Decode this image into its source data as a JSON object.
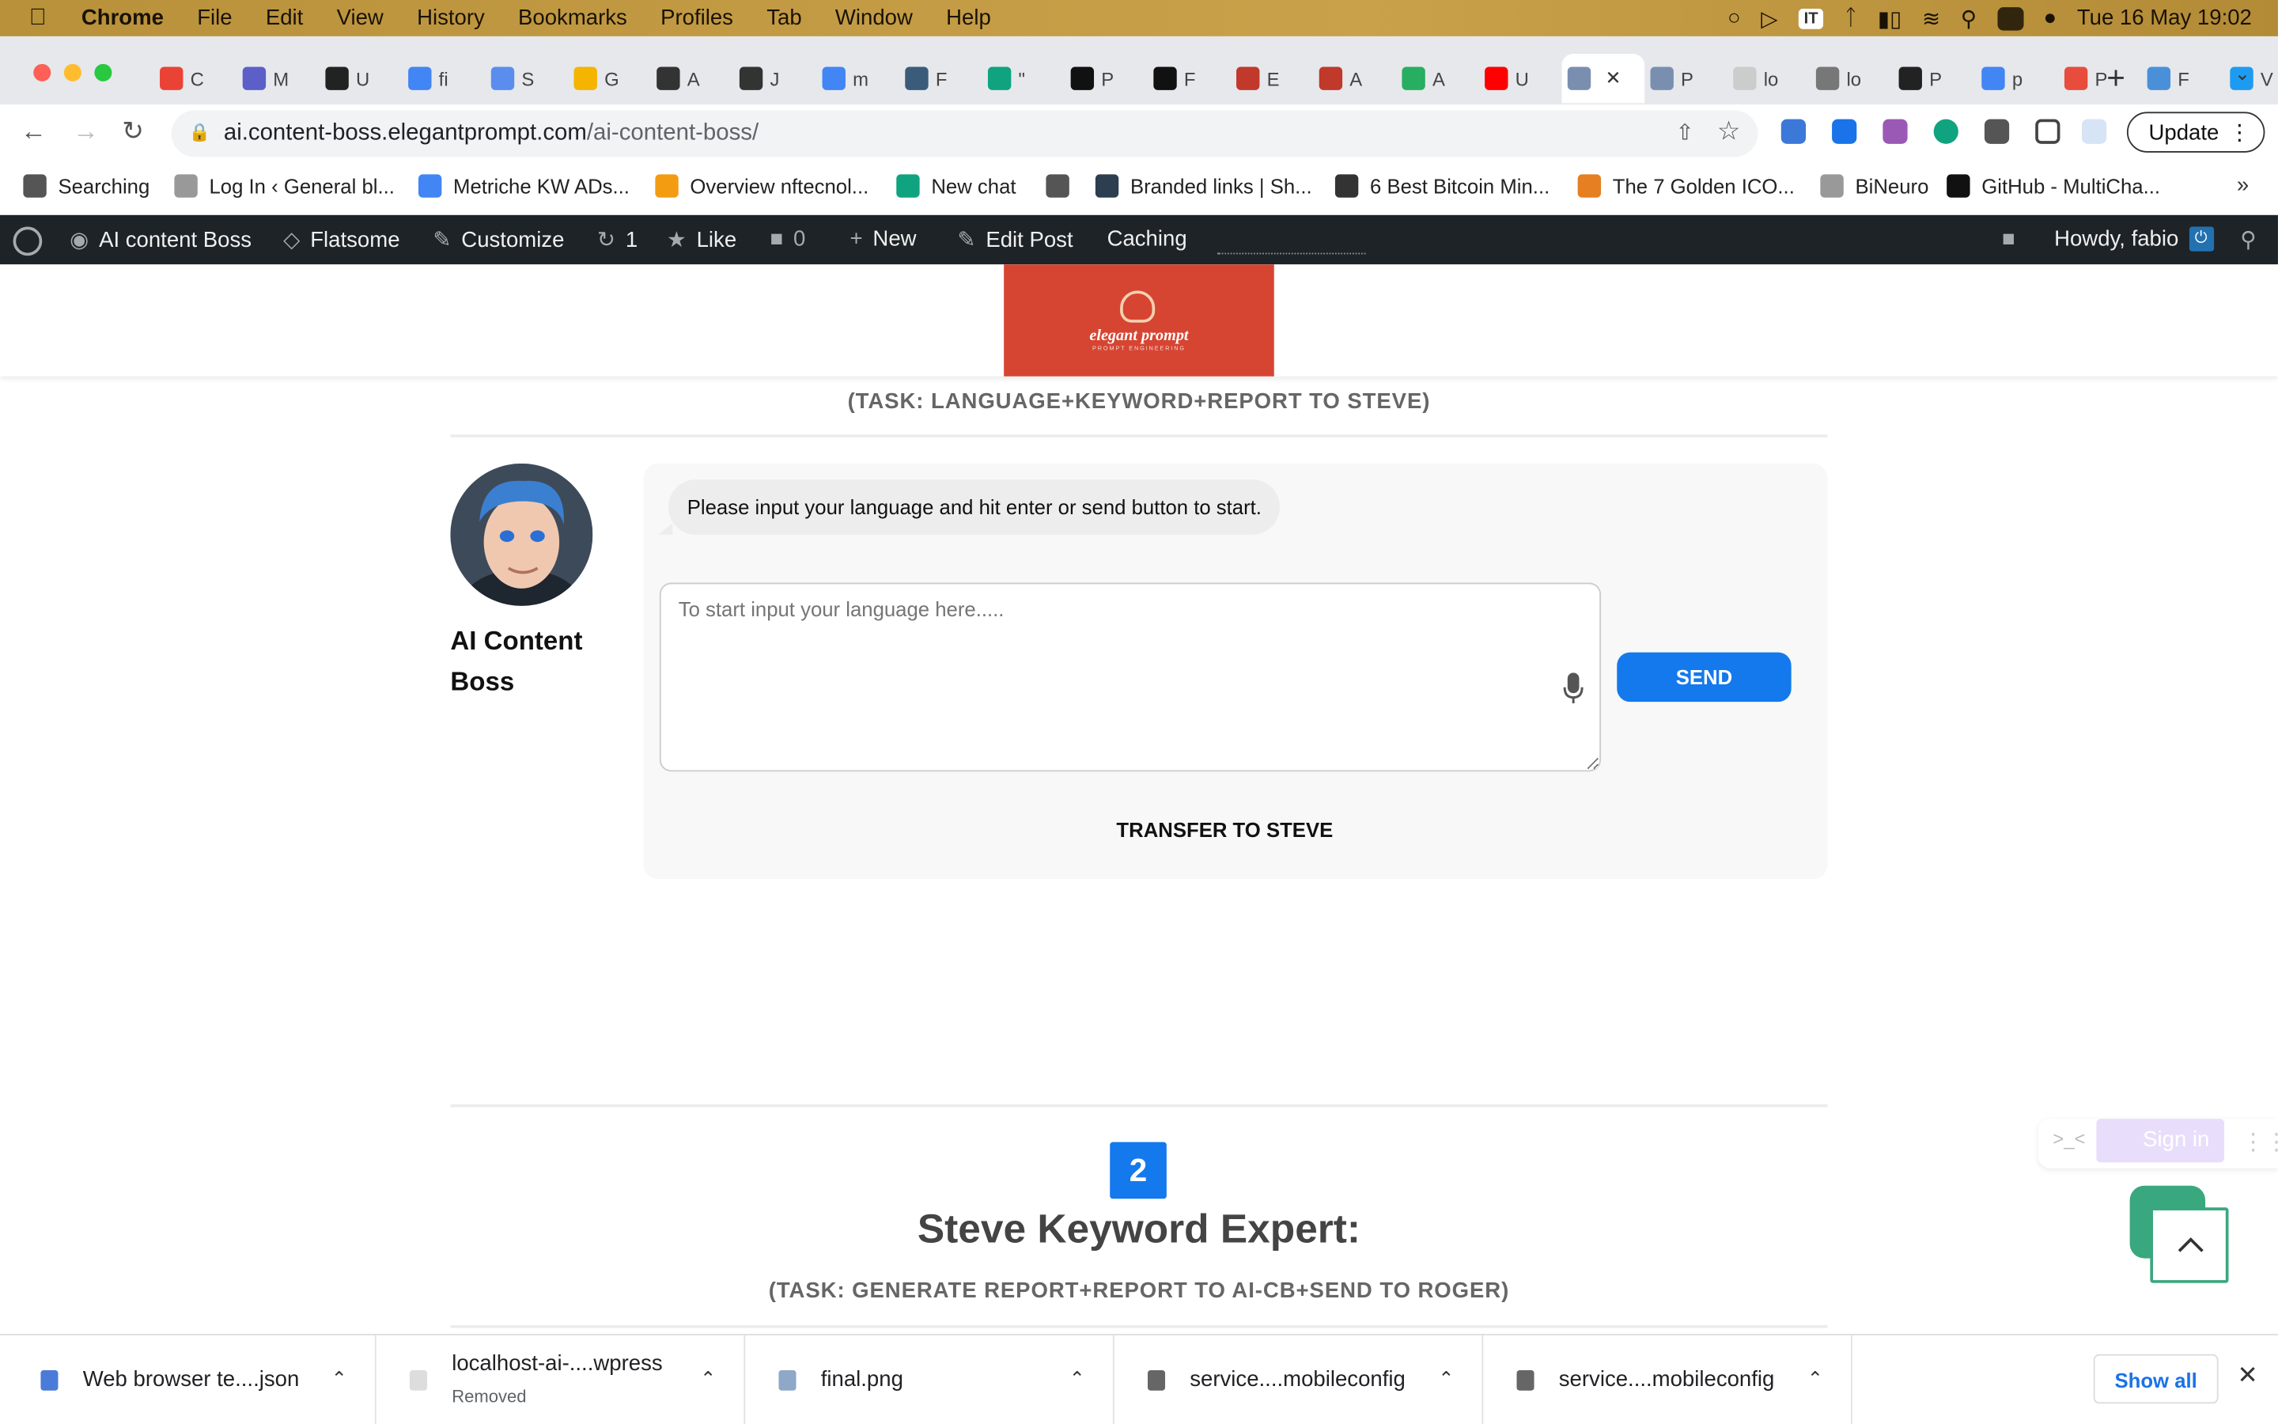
{
  "mac": {
    "app": "Chrome",
    "menus": [
      "File",
      "Edit",
      "View",
      "History",
      "Bookmarks",
      "Profiles",
      "Tab",
      "Window",
      "Help"
    ],
    "input_indicator": "IT",
    "datetime": "Tue 16 May  19:02"
  },
  "tabs": [
    {
      "letter": "C",
      "icon": "gmail-icon",
      "color": "#ea4335"
    },
    {
      "letter": "M",
      "icon": "app-icon",
      "color": "#5b5fc7"
    },
    {
      "letter": "U",
      "icon": "openai-icon",
      "color": "#222222"
    },
    {
      "letter": "fi",
      "icon": "google-icon",
      "color": "#4285f4"
    },
    {
      "letter": "S",
      "icon": "ai-icon",
      "color": "#5a8dee"
    },
    {
      "letter": "G",
      "icon": "bolt-icon",
      "color": "#f4b400"
    },
    {
      "letter": "A",
      "icon": "app-icon",
      "color": "#333333"
    },
    {
      "letter": "J",
      "icon": "app-icon",
      "color": "#333333"
    },
    {
      "letter": "m",
      "icon": "google-icon",
      "color": "#4285f4"
    },
    {
      "letter": "F",
      "icon": "app-icon",
      "color": "#3b5b7a"
    },
    {
      "letter": "\"",
      "icon": "openai-icon",
      "color": "#10a37f"
    },
    {
      "letter": "P",
      "icon": "github-icon",
      "color": "#111111"
    },
    {
      "letter": "F",
      "icon": "github-icon",
      "color": "#111111"
    },
    {
      "letter": "E",
      "icon": "app-icon",
      "color": "#c0392b"
    },
    {
      "letter": "A",
      "icon": "app-icon",
      "color": "#c0392b"
    },
    {
      "letter": "A",
      "icon": "app-icon",
      "color": "#27ae60"
    },
    {
      "letter": "U",
      "icon": "youtube-icon",
      "color": "#ff0000"
    },
    {
      "letter": "",
      "icon": "avatar-icon",
      "color": "#7a8fb0",
      "active": true
    },
    {
      "letter": "P",
      "icon": "avatar-icon",
      "color": "#7a8fb0"
    },
    {
      "letter": "lo",
      "icon": "page-icon",
      "color": "#cccccc"
    },
    {
      "letter": "lo",
      "icon": "globe-icon",
      "color": "#777777"
    },
    {
      "letter": "P",
      "icon": "app-icon",
      "color": "#222222"
    },
    {
      "letter": "p",
      "icon": "google-icon",
      "color": "#4285f4"
    },
    {
      "letter": "P",
      "icon": "app-icon",
      "color": "#e74c3c"
    },
    {
      "letter": "F",
      "icon": "app-icon",
      "color": "#4a90d9"
    },
    {
      "letter": "V",
      "icon": "twitter-icon",
      "color": "#1d9bf0"
    }
  ],
  "toolbar": {
    "url_host": "ai.content-boss.elegantprompt.com",
    "url_path": "/ai-content-boss/",
    "update_label": "Update"
  },
  "bookmarks": [
    {
      "label": "Searching",
      "icon": "globe-icon"
    },
    {
      "label": "Log In ‹ General bl...",
      "icon": "site-icon"
    },
    {
      "label": "Metriche KW ADs...",
      "icon": "google-ads-icon"
    },
    {
      "label": "Overview nftecnol...",
      "icon": "site-icon"
    },
    {
      "label": "New chat",
      "icon": "openai-icon"
    },
    {
      "label": "",
      "icon": "globe-icon"
    },
    {
      "label": "Branded links | Sh...",
      "icon": "site-icon"
    },
    {
      "label": "6 Best Bitcoin Min...",
      "icon": "pickaxe-icon"
    },
    {
      "label": "The 7 Golden ICO...",
      "icon": "site-icon"
    },
    {
      "label": "BiNeuro",
      "icon": "site-icon"
    },
    {
      "label": "GitHub - MultiCha...",
      "icon": "github-icon"
    }
  ],
  "wpbar": {
    "site": "AI content Boss",
    "theme": "Flatsome",
    "customize": "Customize",
    "updates": "1",
    "like": "Like",
    "comments": "0",
    "new": "New",
    "edit": "Edit Post",
    "caching": "Caching",
    "howdy": "Howdy, fabio"
  },
  "logo": {
    "text": "elegant prompt",
    "sub": "PROMPT ENGINEERING"
  },
  "bot": {
    "task": "(TASK: LANGUAGE+KEYWORD+REPORT TO STEVE)",
    "name": "AI Content Boss",
    "message": "Please input your language and hit enter or send button to start.",
    "placeholder": "To start input your language here.....",
    "send_label": "SEND",
    "transfer_label": "TRANSFER TO STEVE"
  },
  "step2": {
    "number": "2",
    "title": "Steve Keyword Expert:",
    "task": "(TASK: GENERATE REPORT+REPORT TO AI-CB+SEND TO ROGER)"
  },
  "widgets": {
    "signin": "Sign in"
  },
  "downloads": [
    {
      "name": "Web browser te....json",
      "status": "",
      "color": "#4a7bd8"
    },
    {
      "name": "localhost-ai-....wpress",
      "status": "Removed",
      "color": "#dddddd"
    },
    {
      "name": "final.png",
      "status": "",
      "color": "#8fa8c8"
    },
    {
      "name": "service....mobileconfig",
      "status": "",
      "color": "#666666"
    },
    {
      "name": "service....mobileconfig",
      "status": "",
      "color": "#666666"
    }
  ],
  "downloads_show_all": "Show all",
  "colors": {
    "accent": "#1479ec",
    "wp_bar": "#1d2327",
    "logo_bg": "#d64532",
    "widget_green": "#3aa87f"
  }
}
